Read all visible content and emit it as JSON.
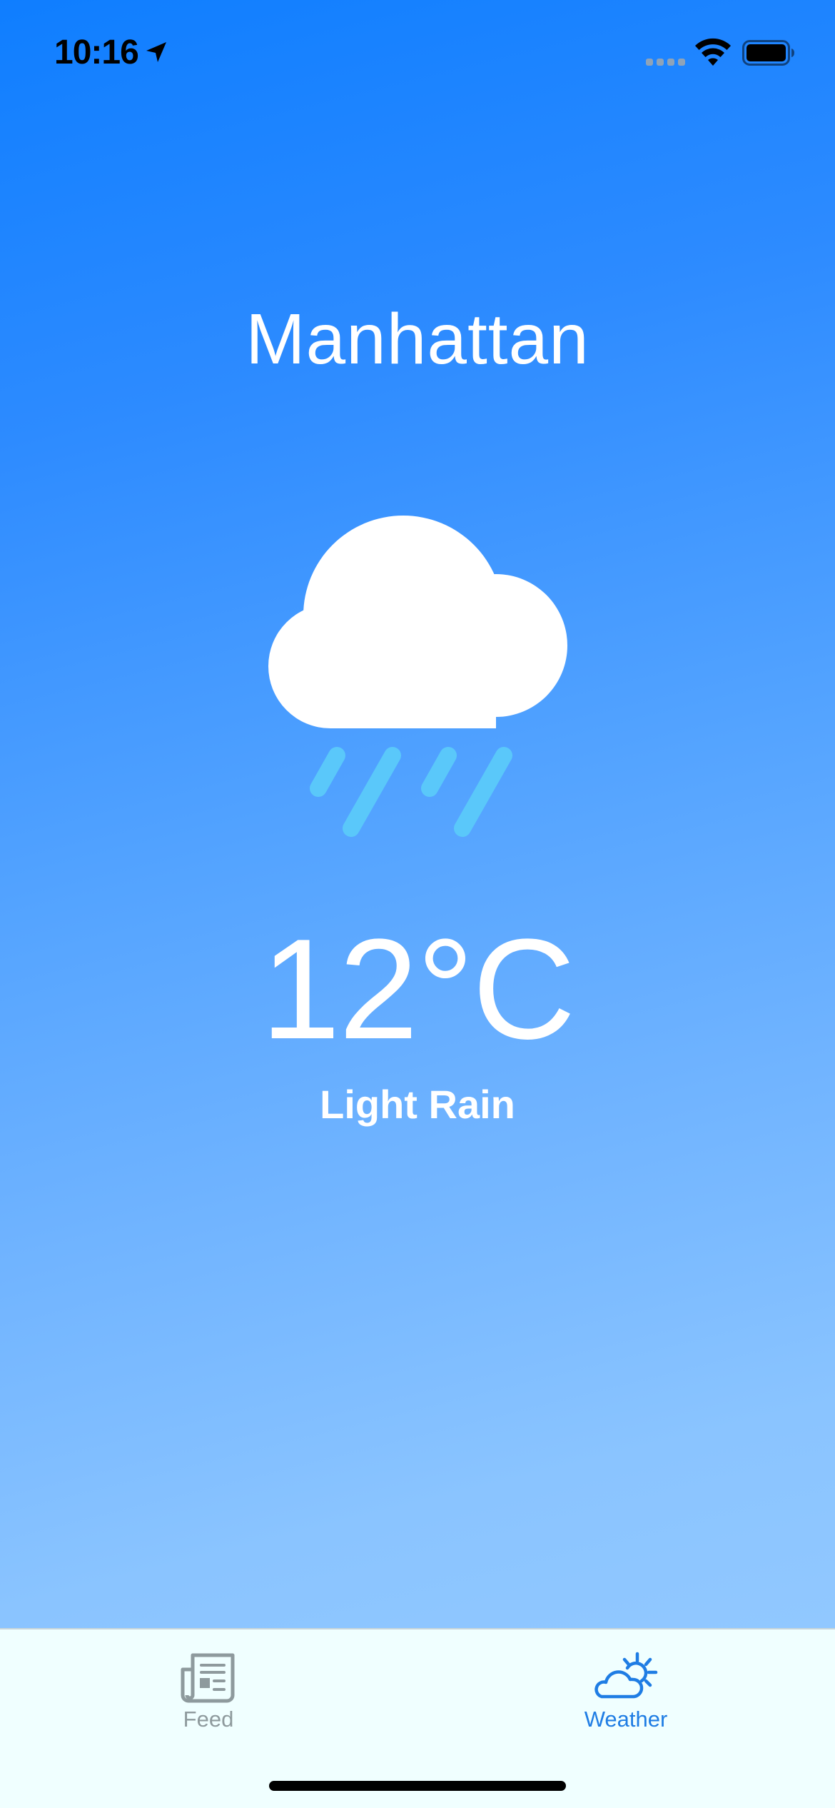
{
  "status_bar": {
    "time": "10:16"
  },
  "weather": {
    "city": "Manhattan",
    "temperature": "12°C",
    "condition": "Light Rain",
    "icon": "cloud-rain-icon"
  },
  "tab_bar": {
    "tabs": [
      {
        "label": "Feed",
        "icon": "newspaper-icon",
        "selected": false
      },
      {
        "label": "Weather",
        "icon": "cloud-sun-icon",
        "selected": true
      }
    ]
  },
  "colors": {
    "background_top": "#0f7eff",
    "background_bottom": "#97cbff",
    "rain": "#5ac8fa",
    "tab_bar_bg": "#f0ffff",
    "tab_active": "#1f7de4",
    "tab_inactive": "#8e9a9d"
  }
}
